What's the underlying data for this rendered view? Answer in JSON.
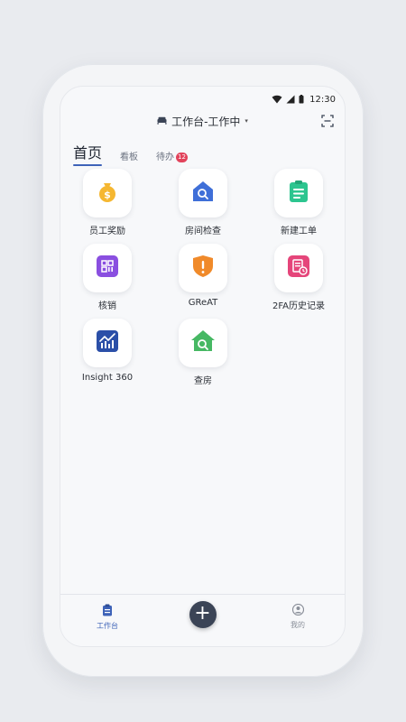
{
  "status_bar": {
    "time": "12:30"
  },
  "header": {
    "title": "工作台-工作中",
    "caret": "▾"
  },
  "tabs": [
    {
      "label": "首页",
      "active": true
    },
    {
      "label": "看板",
      "active": false
    },
    {
      "label": "待办",
      "active": false,
      "badge": "12"
    }
  ],
  "tiles": [
    {
      "label": "员工奖励",
      "icon": "money-bag-icon",
      "color": "#f5b731"
    },
    {
      "label": "房间检查",
      "icon": "house-search-icon",
      "color": "#3f6fd8"
    },
    {
      "label": "新建工单",
      "icon": "clipboard-icon",
      "color": "#2cc58f"
    },
    {
      "label": "核销",
      "icon": "qr-code-icon",
      "color": "#8a4fe0"
    },
    {
      "label": "GReAT",
      "icon": "alert-shield-icon",
      "color": "#f08a2a"
    },
    {
      "label": "2FA历史记录",
      "icon": "history-document-icon",
      "color": "#e5457a"
    },
    {
      "label": "Insight 360",
      "icon": "chart-icon",
      "color": "#2b4fa8"
    },
    {
      "label": "查房",
      "icon": "house-search-green-icon",
      "color": "#46b863"
    }
  ],
  "bottom_nav": {
    "workbench": {
      "label": "工作台",
      "icon": "workbench-icon",
      "active": true
    },
    "add": {
      "label": "+",
      "icon": "plus-icon"
    },
    "mine": {
      "label": "我的",
      "icon": "user-icon",
      "active": false
    }
  },
  "colors": {
    "accent": "#3e63b8",
    "badge": "#e2435b",
    "fab": "#3b4456"
  }
}
